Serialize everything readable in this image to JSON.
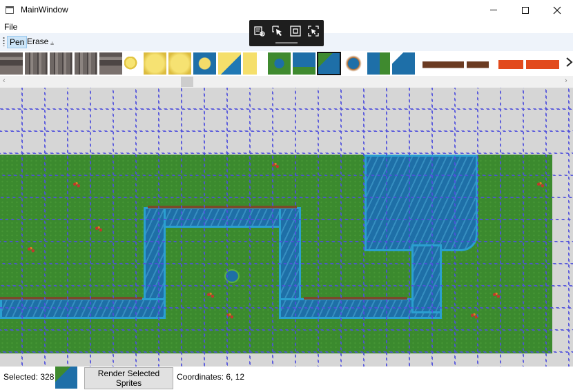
{
  "window": {
    "title": "MainWindow"
  },
  "menu": {
    "file": "File"
  },
  "toolbar": {
    "pen": "Pen",
    "erase": "Erase",
    "overflow_glyph": "⫨"
  },
  "debug_toolbar": {
    "icons": [
      "select-element-icon",
      "pointer-icon",
      "layout-adorner-icon",
      "track-focus-icon"
    ]
  },
  "palette": {
    "tiles": [
      {
        "name": "stone-wall-tile"
      },
      {
        "name": "stone-pillar-tile"
      },
      {
        "name": "stone-pillar-tile"
      },
      {
        "name": "stone-pillar-tile"
      },
      {
        "name": "stone-block-tile"
      },
      {
        "name": "sand-small-tile"
      },
      {
        "name": "sand-full-tile"
      },
      {
        "name": "sand-full-tile"
      },
      {
        "name": "sand-water-tile"
      },
      {
        "name": "sand-water-corner-tile"
      },
      {
        "name": "sand-water-edge-tile"
      },
      {
        "name": "water-hole-tile"
      },
      {
        "name": "water-grass-tile"
      },
      {
        "name": "grass-water-tile",
        "selected": true
      },
      {
        "name": "small-pond-tile"
      },
      {
        "name": "water-grass-edge-tile"
      },
      {
        "name": "water-grass-corner-tile"
      },
      {
        "name": "cliff-tile"
      },
      {
        "name": "cliff-tile"
      },
      {
        "name": "lava-tile"
      },
      {
        "name": "lava-tile"
      }
    ]
  },
  "status": {
    "selected_label": "Selected: 328",
    "render_button": "Render Selected Sprites",
    "coordinates": "Coordinates: 6, 12"
  },
  "colors": {
    "grass": "#3b8a2e",
    "water": "#1e6fa7",
    "grid_line": "#5050dc",
    "empty_cell": "#d6d6d6"
  }
}
